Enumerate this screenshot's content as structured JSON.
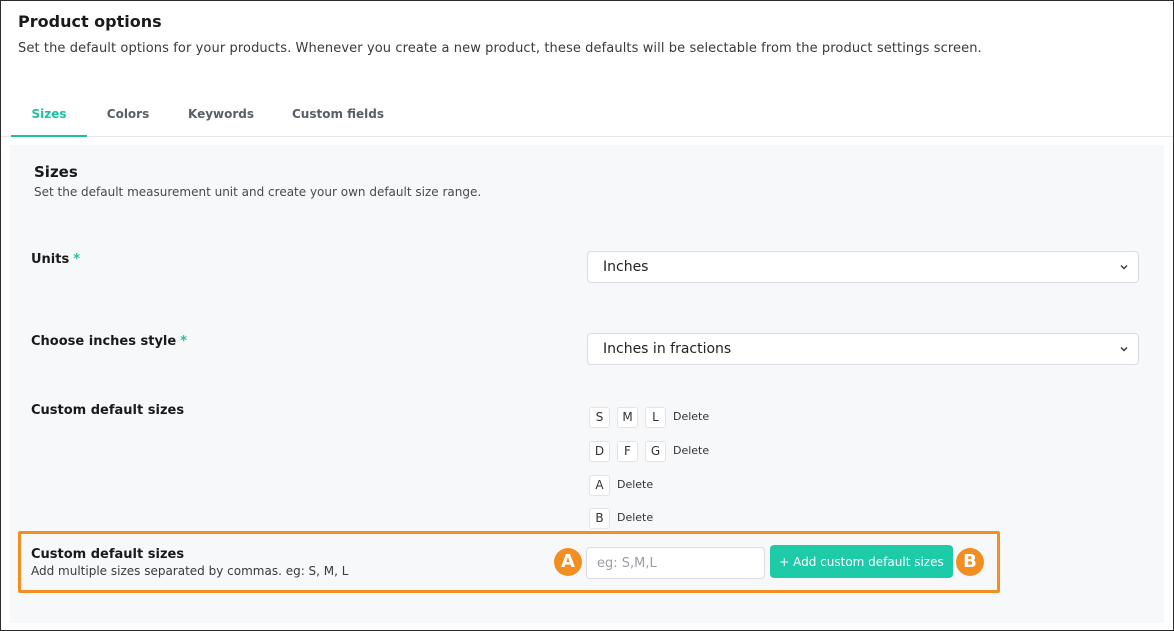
{
  "header": {
    "title": "Product options",
    "subtitle": "Set the default options for your products. Whenever you create a new product, these defaults will be selectable from the product settings screen."
  },
  "tabs": [
    {
      "label": "Sizes",
      "active": true
    },
    {
      "label": "Colors",
      "active": false
    },
    {
      "label": "Keywords",
      "active": false
    },
    {
      "label": "Custom fields",
      "active": false
    }
  ],
  "section": {
    "title": "Sizes",
    "description": "Set the default measurement unit and create your own default size range."
  },
  "units": {
    "label": "Units",
    "required_mark": "*",
    "value": "Inches"
  },
  "inches_style": {
    "label": "Choose inches style",
    "required_mark": "*",
    "value": "Inches in fractions"
  },
  "custom_sizes": {
    "label": "Custom default sizes",
    "delete_label": "Delete",
    "groups": [
      [
        "S",
        "M",
        "L"
      ],
      [
        "D",
        "F",
        "G"
      ],
      [
        "A"
      ],
      [
        "B"
      ]
    ]
  },
  "add_sizes": {
    "label": "Custom default sizes",
    "help": "Add multiple sizes separated by commas. eg: S, M, L",
    "placeholder": "eg: S,M,L",
    "button_label": "+ Add custom default sizes"
  },
  "callouts": {
    "a": "A",
    "b": "B"
  },
  "colors": {
    "accent": "#1fbf9f",
    "button": "#1ecba8",
    "highlight": "#f38f22"
  }
}
